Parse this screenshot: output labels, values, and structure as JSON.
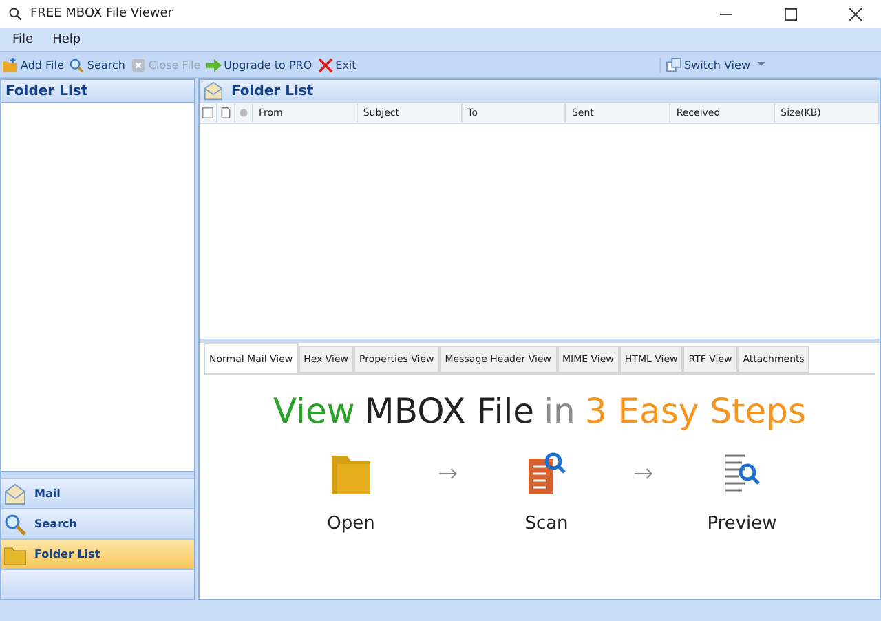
{
  "window": {
    "title": "FREE MBOX File Viewer"
  },
  "menu": [
    "File",
    "Help"
  ],
  "toolbar": [
    {
      "label": "Add File",
      "kind": "add",
      "disabled": false
    },
    {
      "label": "Search",
      "kind": "search",
      "disabled": false
    },
    {
      "label": "Close File",
      "kind": "close",
      "disabled": true
    },
    {
      "label": "Upgrade to PRO",
      "kind": "upgrade",
      "disabled": false
    },
    {
      "label": "Exit",
      "kind": "exit",
      "disabled": false
    }
  ],
  "switch_view": "Switch View",
  "left_panel": {
    "title": "Folder List",
    "nav": [
      {
        "label": "Mail",
        "kind": "mail",
        "selected": false
      },
      {
        "label": "Search",
        "kind": "search",
        "selected": false
      },
      {
        "label": "Folder List",
        "kind": "folder",
        "selected": true
      }
    ]
  },
  "right_panel": {
    "title": "Folder List",
    "columns": [
      "From",
      "Subject",
      "To",
      "Sent",
      "Received",
      "Size(KB)"
    ],
    "tabs": [
      {
        "label": "Normal Mail View",
        "selected": true
      },
      {
        "label": "Hex View",
        "selected": false
      },
      {
        "label": "Properties View",
        "selected": false
      },
      {
        "label": "Message Header View",
        "selected": false
      },
      {
        "label": "MIME View",
        "selected": false
      },
      {
        "label": "HTML View",
        "selected": false
      },
      {
        "label": "RTF View",
        "selected": false
      },
      {
        "label": "Attachments",
        "selected": false
      }
    ],
    "headline": [
      {
        "text": "View",
        "color": "#2aa22a"
      },
      {
        "text": "MBOX File",
        "color": "#222222"
      },
      {
        "text": "in",
        "color": "#8a8a8a"
      },
      {
        "text": "3 Easy Steps",
        "color": "#f7941d"
      }
    ],
    "steps": [
      {
        "label": "Open",
        "kind": "open"
      },
      {
        "label": "Scan",
        "kind": "scan"
      },
      {
        "label": "Preview",
        "kind": "preview"
      }
    ]
  }
}
